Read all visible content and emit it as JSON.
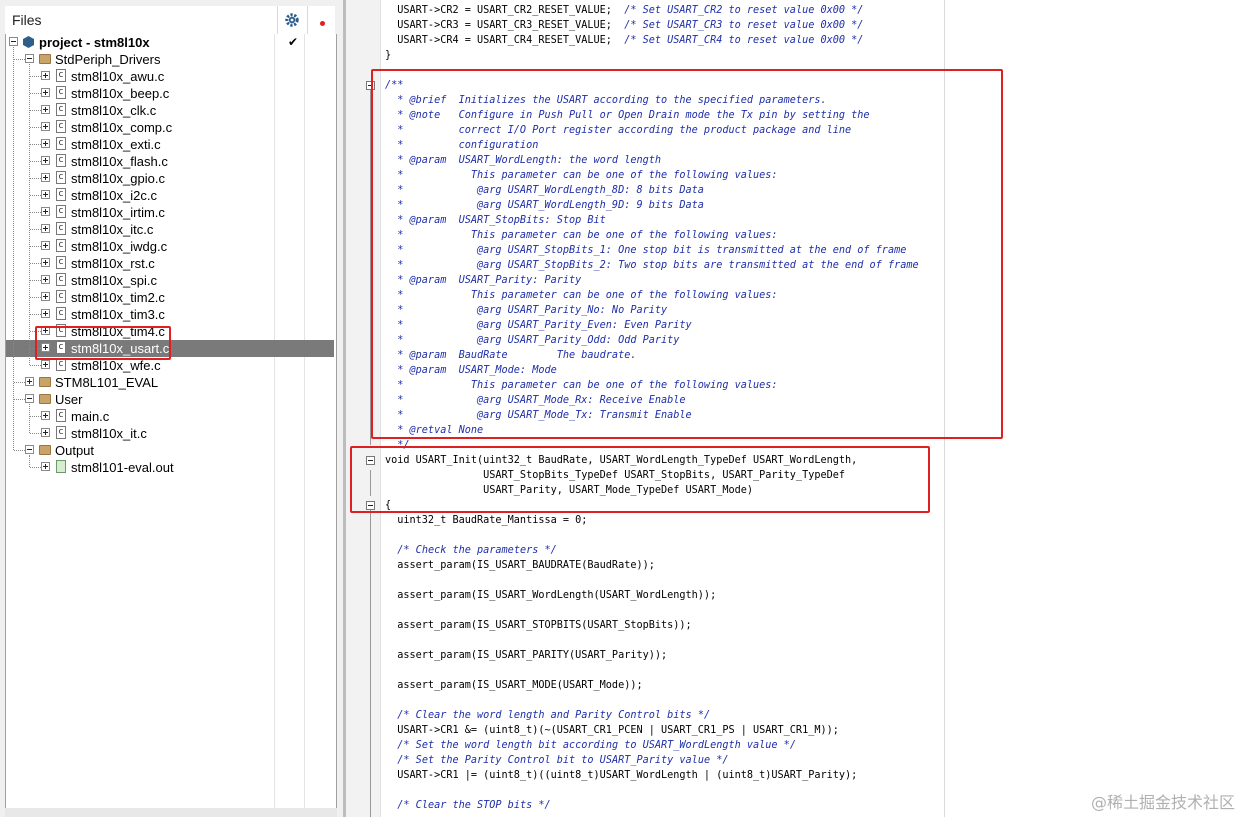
{
  "files_panel": {
    "title": "Files",
    "tree": [
      {
        "label": "project - stm8l10x",
        "depth": 0,
        "expander": "minus",
        "icon": "project-icon",
        "bold": true,
        "checked": true
      },
      {
        "label": "StdPeriph_Drivers",
        "depth": 1,
        "expander": "minus",
        "icon": "folder-icon"
      },
      {
        "label": "stm8l10x_awu.c",
        "depth": 2,
        "expander": "plus",
        "icon": "c-file-icon"
      },
      {
        "label": "stm8l10x_beep.c",
        "depth": 2,
        "expander": "plus",
        "icon": "c-file-icon"
      },
      {
        "label": "stm8l10x_clk.c",
        "depth": 2,
        "expander": "plus",
        "icon": "c-file-icon"
      },
      {
        "label": "stm8l10x_comp.c",
        "depth": 2,
        "expander": "plus",
        "icon": "c-file-icon"
      },
      {
        "label": "stm8l10x_exti.c",
        "depth": 2,
        "expander": "plus",
        "icon": "c-file-icon"
      },
      {
        "label": "stm8l10x_flash.c",
        "depth": 2,
        "expander": "plus",
        "icon": "c-file-icon"
      },
      {
        "label": "stm8l10x_gpio.c",
        "depth": 2,
        "expander": "plus",
        "icon": "c-file-icon"
      },
      {
        "label": "stm8l10x_i2c.c",
        "depth": 2,
        "expander": "plus",
        "icon": "c-file-icon"
      },
      {
        "label": "stm8l10x_irtim.c",
        "depth": 2,
        "expander": "plus",
        "icon": "c-file-icon"
      },
      {
        "label": "stm8l10x_itc.c",
        "depth": 2,
        "expander": "plus",
        "icon": "c-file-icon"
      },
      {
        "label": "stm8l10x_iwdg.c",
        "depth": 2,
        "expander": "plus",
        "icon": "c-file-icon"
      },
      {
        "label": "stm8l10x_rst.c",
        "depth": 2,
        "expander": "plus",
        "icon": "c-file-icon"
      },
      {
        "label": "stm8l10x_spi.c",
        "depth": 2,
        "expander": "plus",
        "icon": "c-file-icon"
      },
      {
        "label": "stm8l10x_tim2.c",
        "depth": 2,
        "expander": "plus",
        "icon": "c-file-icon"
      },
      {
        "label": "stm8l10x_tim3.c",
        "depth": 2,
        "expander": "plus",
        "icon": "c-file-icon"
      },
      {
        "label": "stm8l10x_tim4.c",
        "depth": 2,
        "expander": "plus",
        "icon": "c-file-icon"
      },
      {
        "label": "stm8l10x_usart.c",
        "depth": 2,
        "expander": "plus",
        "icon": "c-file-icon",
        "selected": true
      },
      {
        "label": "stm8l10x_wfe.c",
        "depth": 2,
        "expander": "plus",
        "icon": "c-file-icon"
      },
      {
        "label": "STM8L101_EVAL",
        "depth": 1,
        "expander": "plus",
        "icon": "folder-icon"
      },
      {
        "label": "User",
        "depth": 1,
        "expander": "minus",
        "icon": "folder-icon"
      },
      {
        "label": "main.c",
        "depth": 2,
        "expander": "plus",
        "icon": "c-file-icon"
      },
      {
        "label": "stm8l10x_it.c",
        "depth": 2,
        "expander": "plus",
        "icon": "c-file-icon"
      },
      {
        "label": "Output",
        "depth": 1,
        "expander": "minus",
        "icon": "folder-icon"
      },
      {
        "label": "stm8l101-eval.out",
        "depth": 2,
        "expander": "plus",
        "icon": "output-file-icon"
      }
    ]
  },
  "editor": {
    "lines": [
      {
        "t": "  USART->CR2 = USART_CR2_RESET_VALUE;  ",
        "c": "/* Set USART_CR2 to reset value 0x00 */"
      },
      {
        "t": "  USART->CR3 = USART_CR3_RESET_VALUE;  ",
        "c": "/* Set USART_CR3 to reset value 0x00 */"
      },
      {
        "t": "  USART->CR4 = USART_CR4_RESET_VALUE;  ",
        "c": "/* Set USART_CR4 to reset value 0x00 */"
      },
      {
        "t": "}",
        "c": ""
      },
      {
        "t": "",
        "c": ""
      },
      {
        "t": "",
        "c": "/**"
      },
      {
        "t": "",
        "c": "  * @brief  Initializes the USART according to the specified parameters."
      },
      {
        "t": "",
        "c": "  * @note   Configure in Push Pull or Open Drain mode the Tx pin by setting the"
      },
      {
        "t": "",
        "c": "  *         correct I/O Port register according the product package and line"
      },
      {
        "t": "",
        "c": "  *         configuration"
      },
      {
        "t": "",
        "c": "  * @param  USART_WordLength: the word length"
      },
      {
        "t": "",
        "c": "  *           This parameter can be one of the following values:"
      },
      {
        "t": "",
        "c": "  *            @arg USART_WordLength_8D: 8 bits Data"
      },
      {
        "t": "",
        "c": "  *            @arg USART_WordLength_9D: 9 bits Data"
      },
      {
        "t": "",
        "c": "  * @param  USART_StopBits: Stop Bit"
      },
      {
        "t": "",
        "c": "  *           This parameter can be one of the following values:"
      },
      {
        "t": "",
        "c": "  *            @arg USART_StopBits_1: One stop bit is transmitted at the end of frame"
      },
      {
        "t": "",
        "c": "  *            @arg USART_StopBits_2: Two stop bits are transmitted at the end of frame"
      },
      {
        "t": "",
        "c": "  * @param  USART_Parity: Parity"
      },
      {
        "t": "",
        "c": "  *           This parameter can be one of the following values:"
      },
      {
        "t": "",
        "c": "  *            @arg USART_Parity_No: No Parity"
      },
      {
        "t": "",
        "c": "  *            @arg USART_Parity_Even: Even Parity"
      },
      {
        "t": "",
        "c": "  *            @arg USART_Parity_Odd: Odd Parity"
      },
      {
        "t": "",
        "c": "  * @param  BaudRate        The baudrate."
      },
      {
        "t": "",
        "c": "  * @param  USART_Mode: Mode"
      },
      {
        "t": "",
        "c": "  *           This parameter can be one of the following values:"
      },
      {
        "t": "",
        "c": "  *            @arg USART_Mode_Rx: Receive Enable"
      },
      {
        "t": "",
        "c": "  *            @arg USART_Mode_Tx: Transmit Enable"
      },
      {
        "t": "",
        "c": "  * @retval None"
      },
      {
        "t": "",
        "c": "  */"
      },
      {
        "t": "void USART_Init(uint32_t BaudRate, USART_WordLength_TypeDef USART_WordLength,",
        "c": ""
      },
      {
        "t": "                USART_StopBits_TypeDef USART_StopBits, USART_Parity_TypeDef",
        "c": ""
      },
      {
        "t": "                USART_Parity, USART_Mode_TypeDef USART_Mode)",
        "c": ""
      },
      {
        "t": "{",
        "c": ""
      },
      {
        "t": "  uint32_t BaudRate_Mantissa = 0;",
        "c": ""
      },
      {
        "t": "",
        "c": ""
      },
      {
        "t": "  ",
        "c": "/* Check the parameters */"
      },
      {
        "t": "  assert_param(IS_USART_BAUDRATE(BaudRate));",
        "c": ""
      },
      {
        "t": "",
        "c": ""
      },
      {
        "t": "  assert_param(IS_USART_WordLength(USART_WordLength));",
        "c": ""
      },
      {
        "t": "",
        "c": ""
      },
      {
        "t": "  assert_param(IS_USART_STOPBITS(USART_StopBits));",
        "c": ""
      },
      {
        "t": "",
        "c": ""
      },
      {
        "t": "  assert_param(IS_USART_PARITY(USART_Parity));",
        "c": ""
      },
      {
        "t": "",
        "c": ""
      },
      {
        "t": "  assert_param(IS_USART_MODE(USART_Mode));",
        "c": ""
      },
      {
        "t": "",
        "c": ""
      },
      {
        "t": "  ",
        "c": "/* Clear the word length and Parity Control bits */"
      },
      {
        "t": "  USART->CR1 &= (uint8_t)(~(USART_CR1_PCEN | USART_CR1_PS | USART_CR1_M));",
        "c": ""
      },
      {
        "t": "  ",
        "c": "/* Set the word length bit according to USART_WordLength value */"
      },
      {
        "t": "  ",
        "c": "/* Set the Parity Control bit to USART_Parity value */"
      },
      {
        "t": "  USART->CR1 |= (uint8_t)((uint8_t)USART_WordLength | (uint8_t)USART_Parity);",
        "c": ""
      },
      {
        "t": "",
        "c": ""
      },
      {
        "t": "  ",
        "c": "/* Clear the STOP bits */"
      }
    ]
  },
  "watermark": "@稀土掘金技术社区"
}
